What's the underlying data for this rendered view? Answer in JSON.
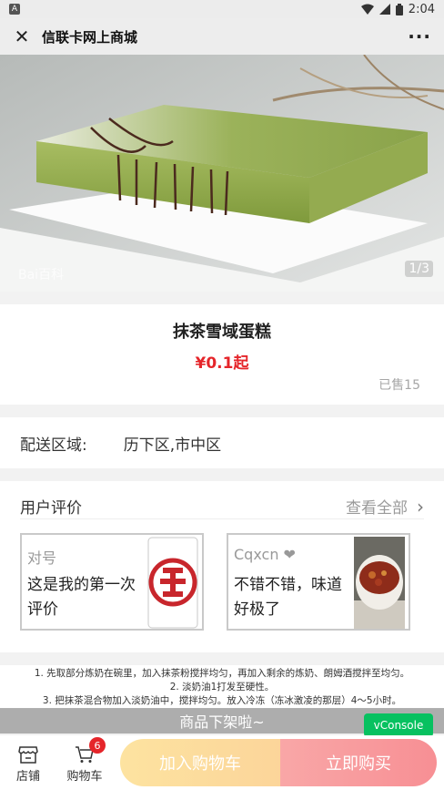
{
  "status_bar": {
    "badge": "A",
    "time": "2:04"
  },
  "header": {
    "title": "信联卡网上商城"
  },
  "gallery": {
    "counter": "1/3",
    "watermark": "Bai百科"
  },
  "product": {
    "name": "抹茶雪域蛋糕",
    "price": "¥0.1起",
    "sold": "已售15"
  },
  "delivery": {
    "label": "配送区域:",
    "value": "历下区,市中区"
  },
  "reviews": {
    "title": "用户评价",
    "view_all": "查看全部",
    "items": [
      {
        "user": "对号",
        "text": "这是我的第一次评价"
      },
      {
        "user": "Cqxcn ❤",
        "text": "不错不错，味道好极了"
      }
    ]
  },
  "description": {
    "lines": [
      "1. 先取部分炼奶在碗里，加入抹茶粉搅拌均匀，再加入剩余的炼奶、朗姆酒搅拌至均匀。",
      "2. 淡奶油1打发至硬性。",
      "3. 把抹茶混合物加入淡奶油中，搅拌均匀。放入冷冻（冻冰激凌的那层）4～5小时。"
    ]
  },
  "offline_notice": "商品下架啦~",
  "vconsole_label": "vConsole",
  "bottom_bar": {
    "shop_label": "店铺",
    "cart_label": "购物车",
    "cart_count": "6",
    "add_to_cart_label": "加入购物车",
    "buy_now_label": "立即购买"
  },
  "colors": {
    "price_red": "#e5252a",
    "vconsole_green": "#07c160"
  }
}
